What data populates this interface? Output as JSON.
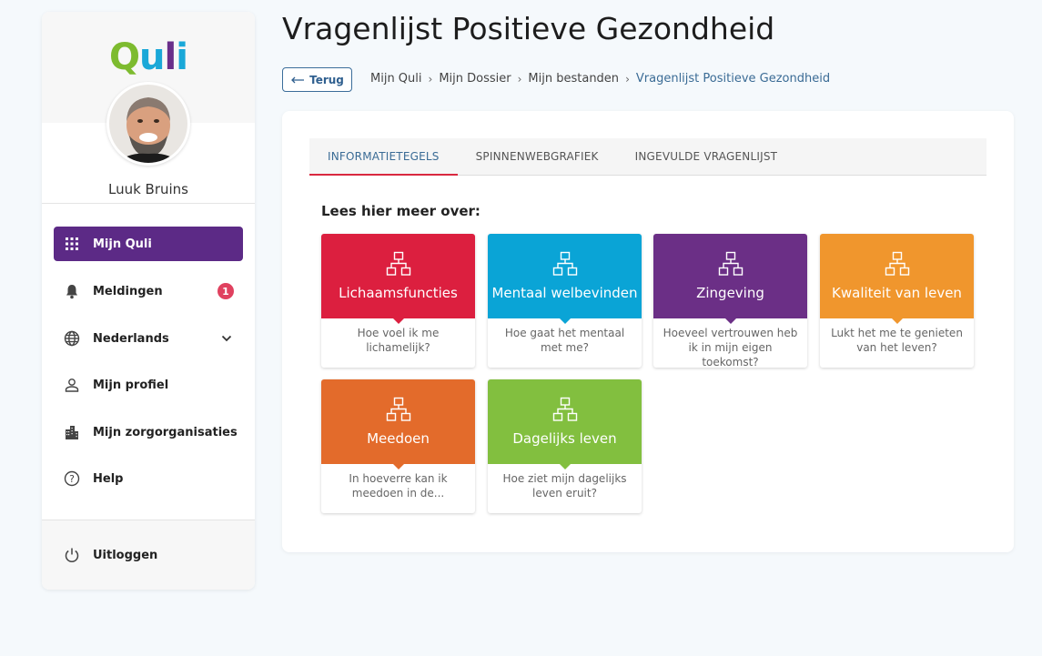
{
  "sidebar": {
    "logo": {
      "q": "Q",
      "u": "u",
      "l": "l",
      "i": "i"
    },
    "user_name": "Luuk Bruins",
    "items": [
      {
        "label": "Mijn Quli",
        "icon": "grid-icon",
        "active": true
      },
      {
        "label": "Meldingen",
        "icon": "bell-icon",
        "badge": "1"
      },
      {
        "label": "Nederlands",
        "icon": "globe-icon"
      },
      {
        "label": "Mijn profiel",
        "icon": "person-icon"
      },
      {
        "label": "Mijn zorgorganisaties",
        "icon": "building-icon"
      },
      {
        "label": "Help",
        "icon": "help-icon"
      }
    ],
    "logout_label": "Uitloggen"
  },
  "header": {
    "title": "Vragenlijst Positieve Gezondheid",
    "back_label": "Terug",
    "breadcrumb": [
      "Mijn Quli",
      "Mijn Dossier",
      "Mijn bestanden",
      "Vragenlijst Positieve Gezondheid"
    ]
  },
  "tabs": [
    "INFORMATIETEGELS",
    "SPINNENWEBGRAFIEK",
    "INGEVULDE VRAGENLIJST"
  ],
  "section_heading": "Lees hier meer over:",
  "tiles": [
    {
      "title": "Lichaamsfuncties",
      "desc": "Hoe voel ik me lichamelijk?",
      "color": "#dc1f3f"
    },
    {
      "title": "Mentaal welbevinden",
      "desc": "Hoe gaat het mentaal met me?",
      "color": "#0aa4d6"
    },
    {
      "title": "Zingeving",
      "desc": "Hoeveel vertrouwen heb ik in mijn eigen toekomst?",
      "color": "#6b2f86"
    },
    {
      "title": "Kwaliteit van leven",
      "desc": "Lukt het me te genieten van het leven?",
      "color": "#f0962d"
    },
    {
      "title": "Meedoen",
      "desc": "In hoeverre kan ik meedoen in de...",
      "color": "#e36b2b"
    },
    {
      "title": "Dagelijks leven",
      "desc": "Hoe ziet mijn dagelijks leven eruit?",
      "color": "#82bf3f"
    }
  ],
  "colors": {
    "primary": "#5c2a86",
    "badge": "#e0415f",
    "link": "#3a6b95",
    "active_tab_underline": "#d9283f"
  }
}
